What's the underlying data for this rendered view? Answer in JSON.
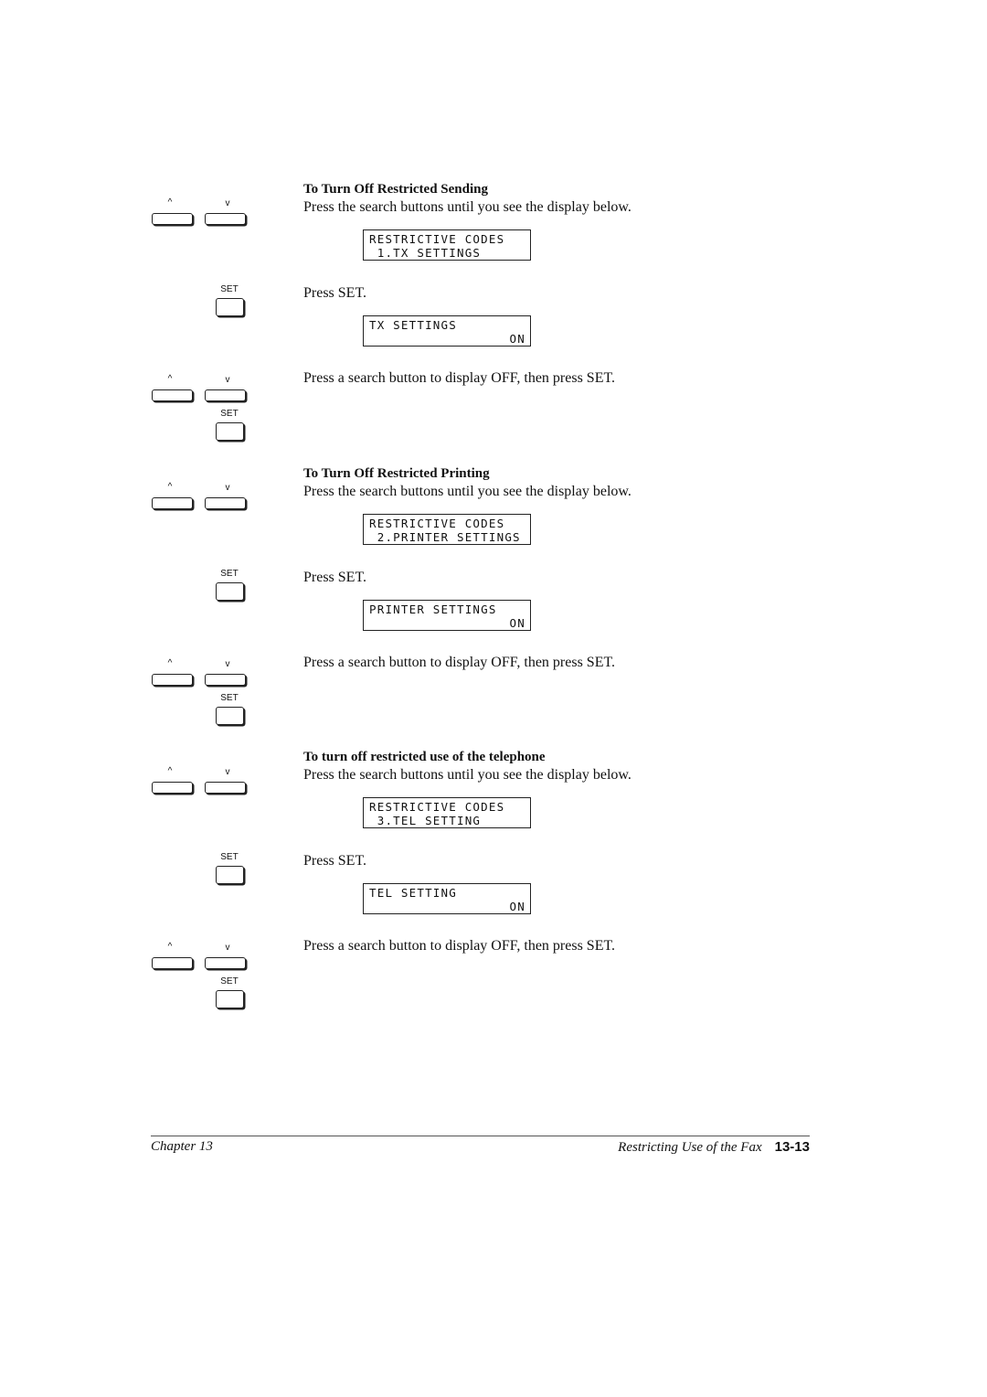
{
  "sections": [
    {
      "heading": "To Turn Off Restricted Sending",
      "step1_text": "Press the search buttons until you see the display below.",
      "display1": {
        "line1": "RESTRICTIVE CODES",
        "line2": " 1.TX SETTINGS"
      },
      "step2_text": "Press SET.",
      "display2": {
        "line1": "TX SETTINGS",
        "line2": "ON"
      },
      "step3_text": "Press a search button to display OFF, then press SET."
    },
    {
      "heading": "To Turn Off Restricted Printing",
      "step1_text": "Press the search buttons until you see the display below.",
      "display1": {
        "line1": "RESTRICTIVE CODES",
        "line2": " 2.PRINTER SETTINGS"
      },
      "step2_text": "Press SET.",
      "display2": {
        "line1": "PRINTER SETTINGS",
        "line2": "ON"
      },
      "step3_text": "Press a search button to display OFF, then press SET."
    },
    {
      "heading": "To turn off restricted use of the telephone",
      "step1_text": "Press the search buttons until you see the display below.",
      "display1": {
        "line1": "RESTRICTIVE CODES",
        "line2": " 3.TEL SETTING"
      },
      "step2_text": "Press SET.",
      "display2": {
        "line1": "TEL SETTING",
        "line2": "ON"
      },
      "step3_text": "Press a search button to display OFF, then press SET."
    }
  ],
  "keys": {
    "up_label": "^",
    "down_label": "v",
    "set_label": "SET"
  },
  "footer": {
    "chapter": "Chapter 13",
    "title": "Restricting Use of the Fax",
    "page_number": "13-13"
  }
}
